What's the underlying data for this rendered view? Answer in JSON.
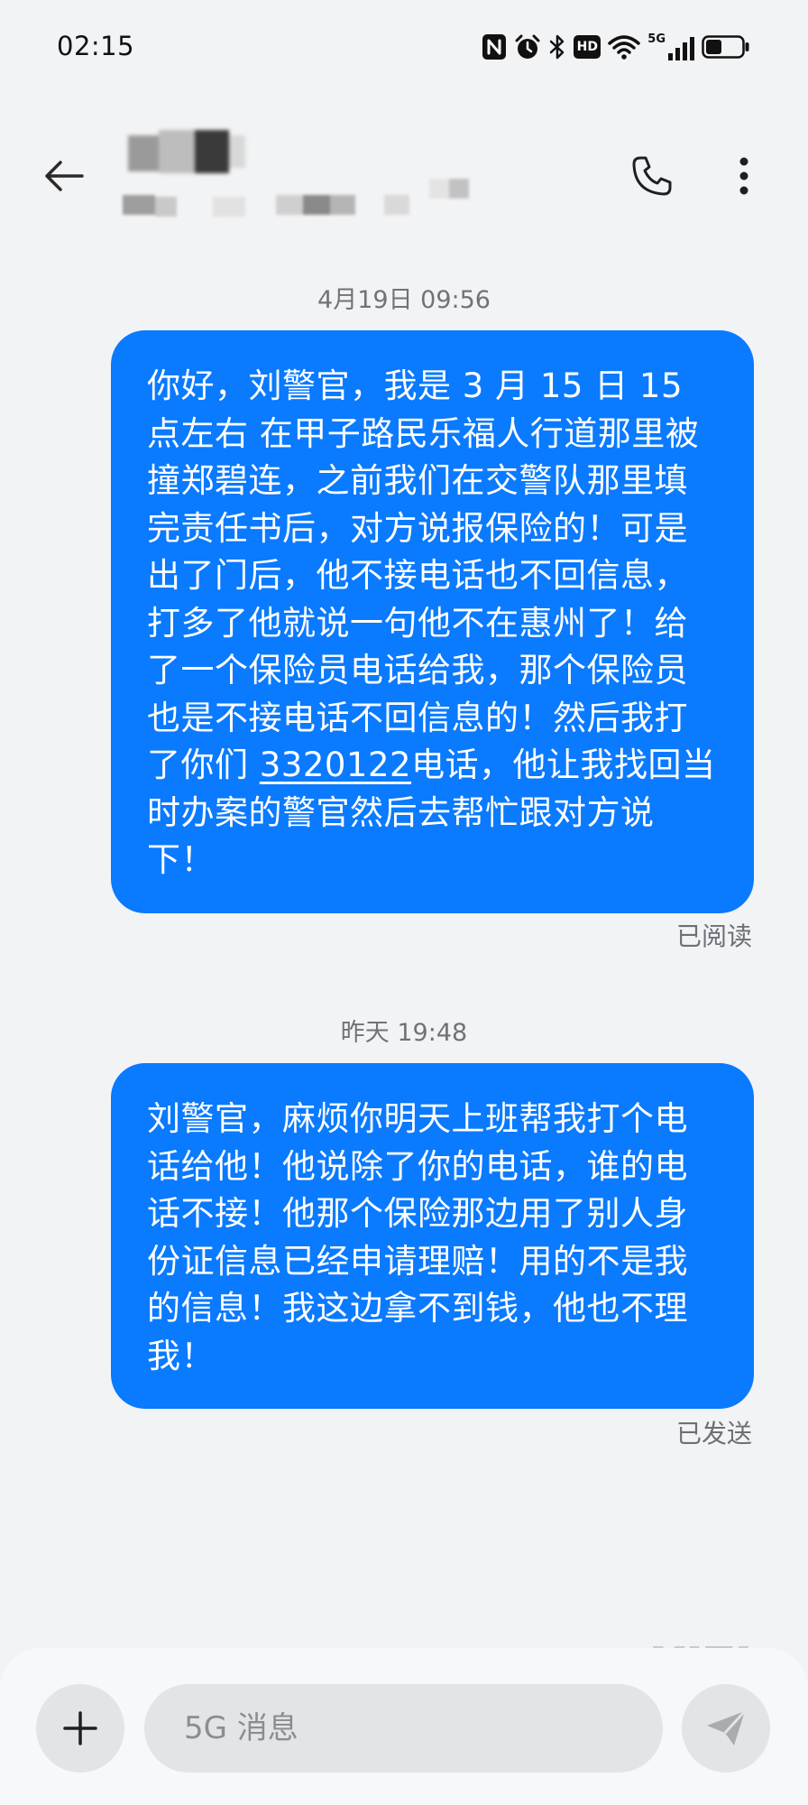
{
  "status_bar": {
    "time": "02:15",
    "icons": [
      "nfc-icon",
      "alarm-icon",
      "bluetooth-icon",
      "hd-icon",
      "wifi-icon",
      "5g-signal-icon",
      "battery-icon"
    ],
    "hd_label": "HD",
    "network_label": "5G"
  },
  "header": {
    "back_icon": "arrow-left-icon",
    "call_icon": "phone-icon",
    "more_icon": "more-vertical-icon"
  },
  "messages": [
    {
      "date": "4月19日 09:56",
      "text_before_link": "你好，刘警官，我是 3 月 15 日 15 点左右 在甲子路民乐福人行道那里被撞郑碧连，之前我们在交警队那里填完责任书后，对方说报保险的！可是出了门后，他不接电话也不回信息，打多了他就说一句他不在惠州了！给了一个保险员电话给我，那个保险员也是不接电话不回信息的！然后我打了你们 ",
      "link_text": "3320122",
      "text_after_link": "电话，他让我找回当时办案的警官然后去帮忙跟对方说下！",
      "status": "已阅读"
    },
    {
      "date": "昨天 19:48",
      "text": "刘警官，麻烦你明天上班帮我打个电话给他！他说除了你的电话，谁的电话不接！他那个保险那边用了别人身份证信息已经申请理赔！用的不是我的信息！我这边拿不到钱，他也不理我！",
      "status": "已发送"
    }
  ],
  "compose": {
    "placeholder": "5G 消息",
    "add_icon": "plus-icon",
    "send_icon": "send-icon"
  },
  "colors": {
    "background": "#f2f3f5",
    "bubble": "#0a7aff",
    "bubble_text": "#ffffff",
    "meta_text": "#6f7378"
  }
}
